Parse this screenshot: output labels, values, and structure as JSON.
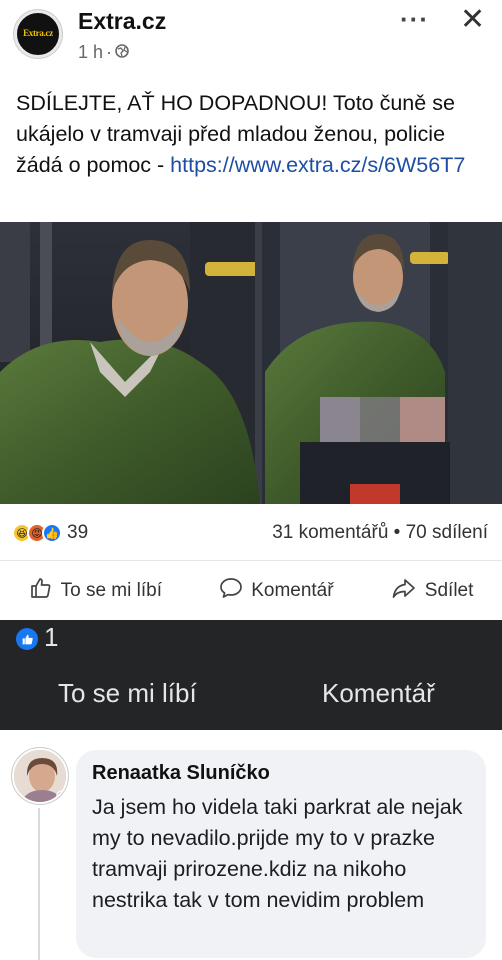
{
  "post": {
    "page_name": "Extra.cz",
    "avatar_text": "Extra.cz",
    "time": "1 h",
    "separator": "·",
    "text": "SDÍLEJTE, AŤ HO DOPADNOU! Toto čuně se ukájelo v tramvaji před mladou ženou, policie žádá o pomoc - ",
    "link": "https://www.extra.cz/s/6W56T7",
    "more_label": "···",
    "close_label": "✕",
    "icons": [
      "globe-icon",
      "more-icon",
      "close-icon"
    ]
  },
  "stats": {
    "reaction_count": "39",
    "comments_shares": "31 komentářů • 70 sdílení",
    "reaction_icons": [
      "haha-icon",
      "angry-icon",
      "like-icon"
    ]
  },
  "actions": {
    "like": "To se mi líbí",
    "comment": "Komentář",
    "share": "Sdílet"
  },
  "dark_section": {
    "like_count": "1",
    "like": "To se mi líbí",
    "comment": "Komentář",
    "colors": {
      "background": "#242526",
      "text": "#e4e6eb",
      "accent": "#1877f2"
    }
  },
  "comment": {
    "author": "Renaatka Sluníčko",
    "text": "Ja jsem ho videla taki parkrat ale nejak my to nevadilo.prijde my to v prazke tramvaji prirozene.kdiz na nikoho nestrika tak v tom nevidim problem"
  }
}
